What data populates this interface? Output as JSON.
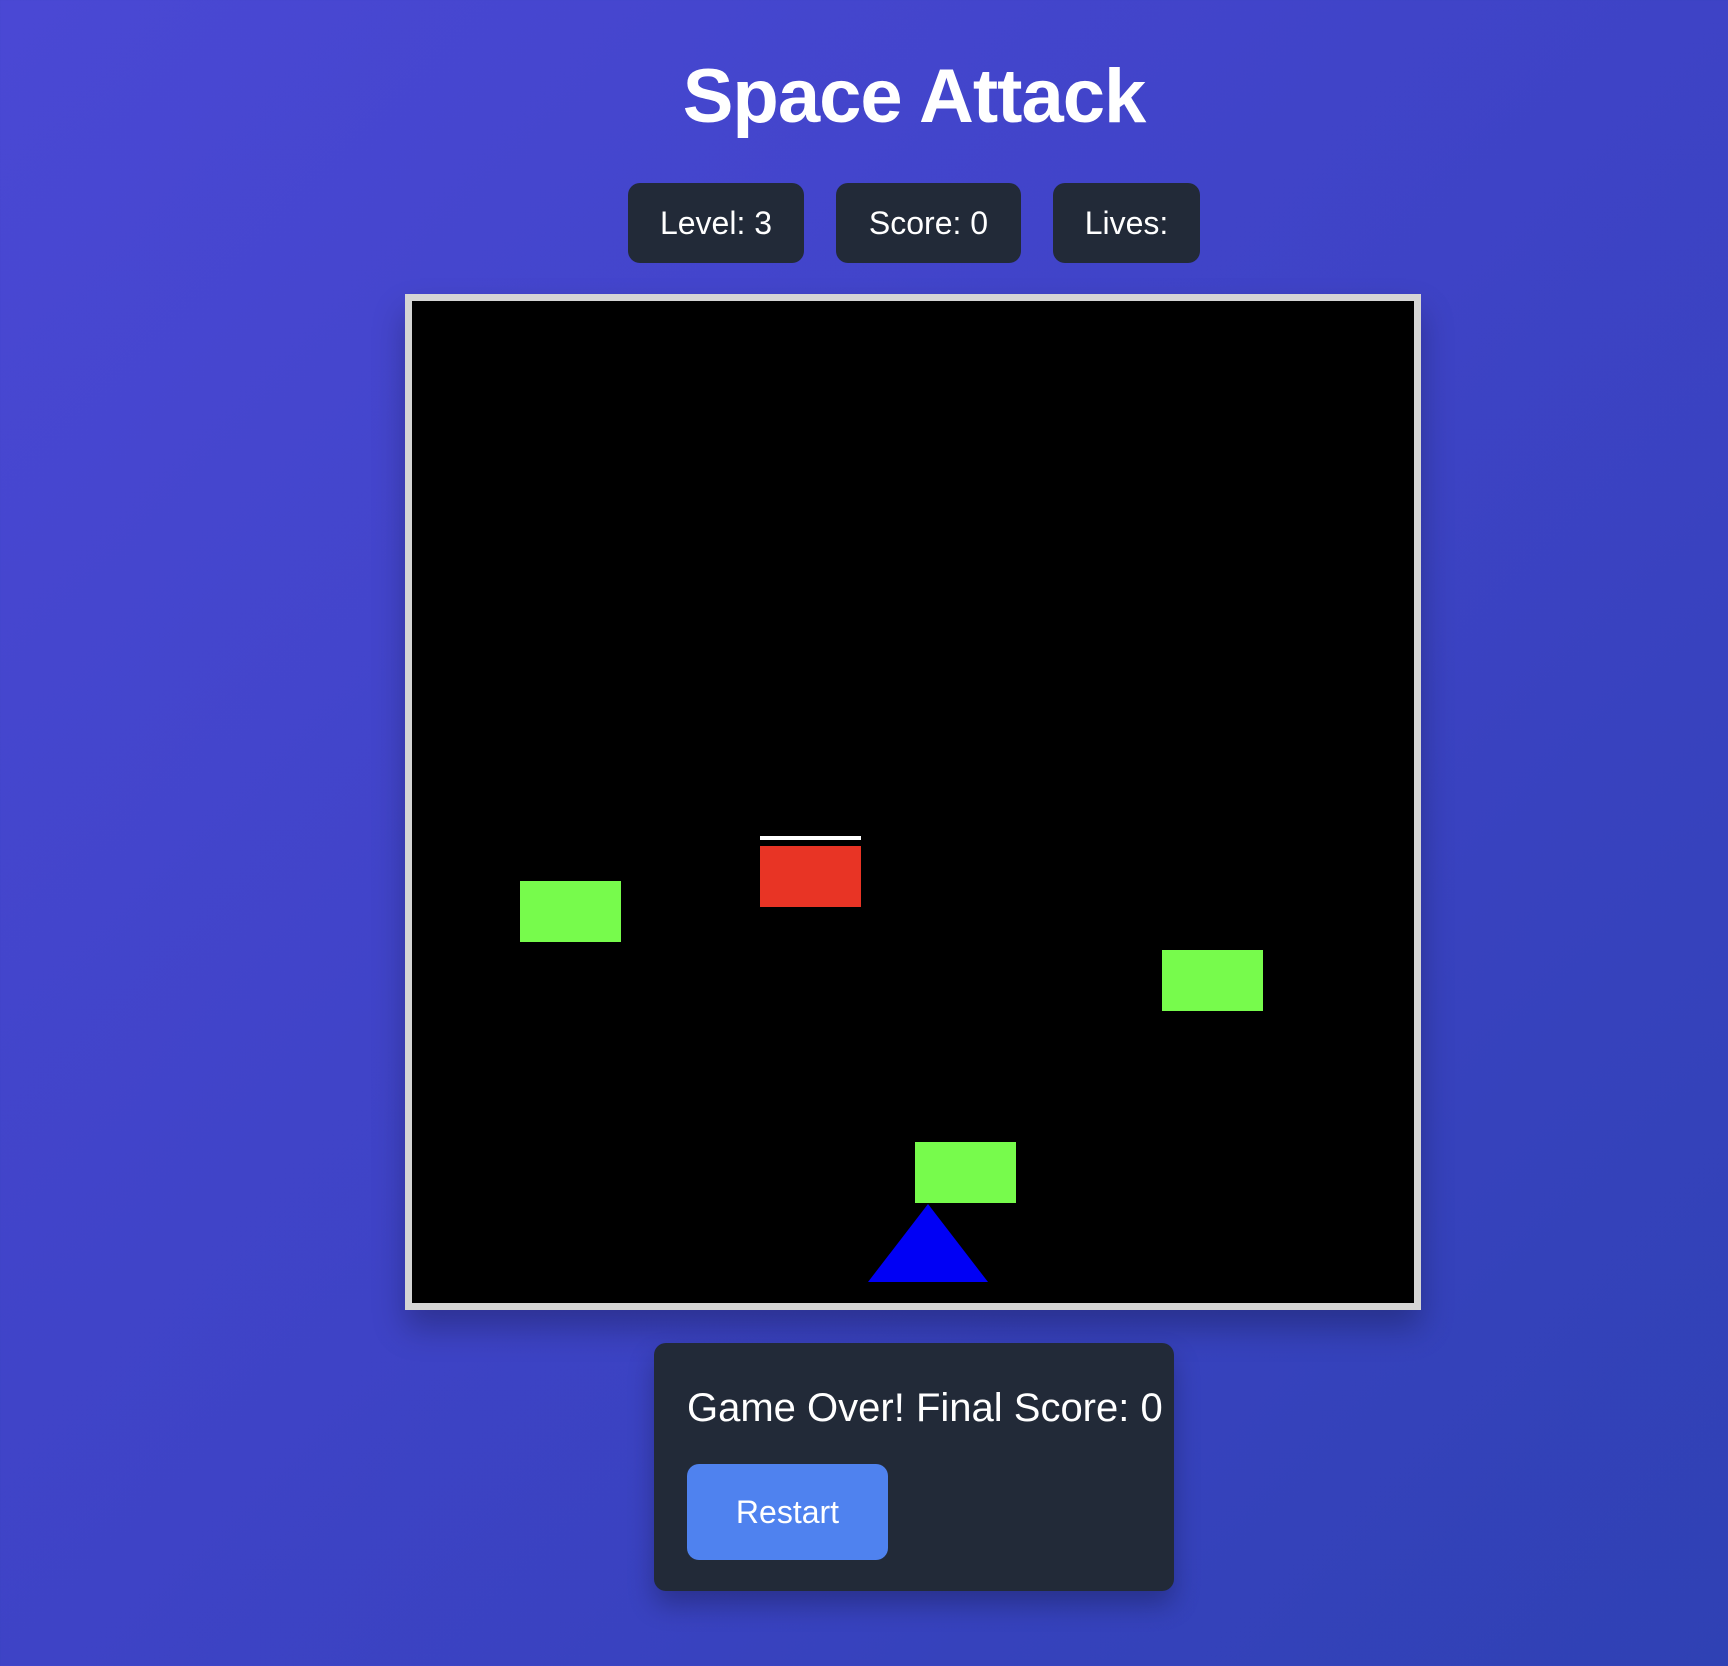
{
  "app": {
    "title": "Space Attack"
  },
  "stats": {
    "level": "Level: 3",
    "score": "Score: 0",
    "lives": "Lives:"
  },
  "game": {
    "background_color": "#000000",
    "enemy_color": "#77fb4c",
    "hit_enemy_color": "#e83425",
    "player_color": "#0000f5",
    "bullet_color": "#ffffff",
    "entities": [
      {
        "name": "enemy",
        "kind": "enemy"
      },
      {
        "name": "enemy-hit",
        "kind": "enemy-hit"
      },
      {
        "name": "enemy",
        "kind": "enemy"
      },
      {
        "name": "enemy",
        "kind": "enemy"
      },
      {
        "name": "bullet",
        "kind": "bullet"
      },
      {
        "name": "player-ship",
        "kind": "player"
      }
    ]
  },
  "game_over": {
    "message": "Game Over! Final Score: 0",
    "restart_label": "Restart"
  }
}
